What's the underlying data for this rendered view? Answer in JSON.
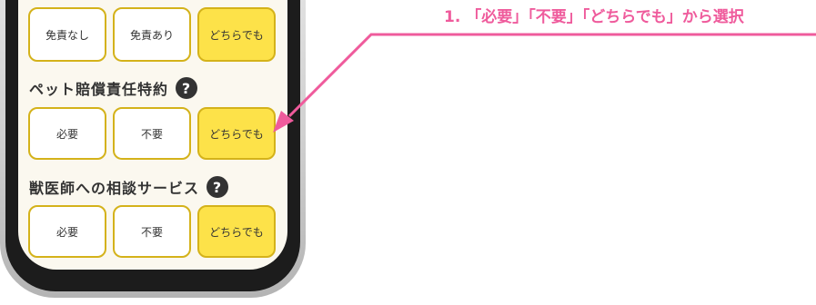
{
  "annotation": {
    "text": "1. 「必要」「不要」「どちらでも」から選択",
    "color": "#ef5b9c"
  },
  "sections": [
    {
      "options": [
        "免責なし",
        "免責あり",
        "どちらでも"
      ],
      "selected": 2
    },
    {
      "title": "ペット賠償責任特約",
      "options": [
        "必要",
        "不要",
        "どちらでも"
      ],
      "selected": 2,
      "help_icon": "question-icon"
    },
    {
      "title": "獣医師への相談サービス",
      "options": [
        "必要",
        "不要",
        "どちらでも"
      ],
      "selected": 2,
      "help_icon": "question-icon"
    }
  ],
  "colors": {
    "selected_fill": "#fde249",
    "option_border": "#d4b21a",
    "screen_bg": "#fbf8ef"
  }
}
